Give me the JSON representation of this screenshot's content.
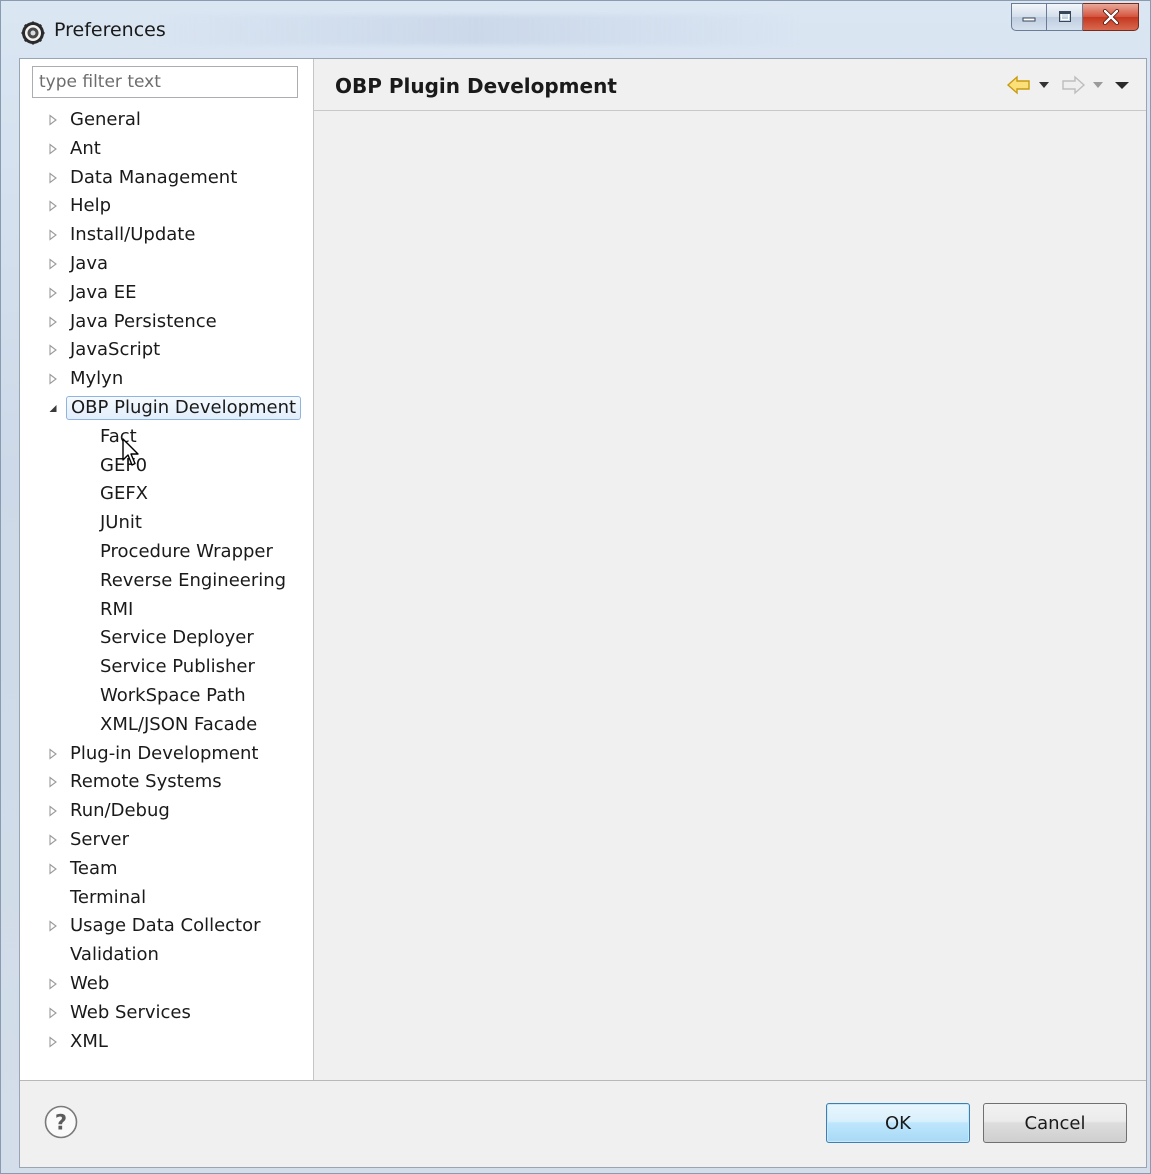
{
  "window": {
    "title": "Preferences"
  },
  "filter": {
    "placeholder": "type filter text",
    "value": ""
  },
  "tree": {
    "items": [
      {
        "label": "General",
        "expandable": true,
        "expanded": false,
        "level": 0
      },
      {
        "label": "Ant",
        "expandable": true,
        "expanded": false,
        "level": 0
      },
      {
        "label": "Data Management",
        "expandable": true,
        "expanded": false,
        "level": 0
      },
      {
        "label": "Help",
        "expandable": true,
        "expanded": false,
        "level": 0
      },
      {
        "label": "Install/Update",
        "expandable": true,
        "expanded": false,
        "level": 0
      },
      {
        "label": "Java",
        "expandable": true,
        "expanded": false,
        "level": 0
      },
      {
        "label": "Java EE",
        "expandable": true,
        "expanded": false,
        "level": 0
      },
      {
        "label": "Java Persistence",
        "expandable": true,
        "expanded": false,
        "level": 0
      },
      {
        "label": "JavaScript",
        "expandable": true,
        "expanded": false,
        "level": 0
      },
      {
        "label": "Mylyn",
        "expandable": true,
        "expanded": false,
        "level": 0
      },
      {
        "label": "OBP Plugin Development",
        "expandable": true,
        "expanded": true,
        "level": 0,
        "selected": true
      },
      {
        "label": "Fact",
        "expandable": false,
        "level": 1
      },
      {
        "label": "GEF0",
        "expandable": false,
        "level": 1
      },
      {
        "label": "GEFX",
        "expandable": false,
        "level": 1
      },
      {
        "label": "JUnit",
        "expandable": false,
        "level": 1
      },
      {
        "label": "Procedure Wrapper",
        "expandable": false,
        "level": 1
      },
      {
        "label": "Reverse Engineering",
        "expandable": false,
        "level": 1
      },
      {
        "label": "RMI",
        "expandable": false,
        "level": 1
      },
      {
        "label": "Service Deployer",
        "expandable": false,
        "level": 1
      },
      {
        "label": "Service Publisher",
        "expandable": false,
        "level": 1
      },
      {
        "label": "WorkSpace Path",
        "expandable": false,
        "level": 1
      },
      {
        "label": "XML/JSON Facade",
        "expandable": false,
        "level": 1
      },
      {
        "label": "Plug-in Development",
        "expandable": true,
        "expanded": false,
        "level": 0
      },
      {
        "label": "Remote Systems",
        "expandable": true,
        "expanded": false,
        "level": 0
      },
      {
        "label": "Run/Debug",
        "expandable": true,
        "expanded": false,
        "level": 0
      },
      {
        "label": "Server",
        "expandable": true,
        "expanded": false,
        "level": 0
      },
      {
        "label": "Team",
        "expandable": true,
        "expanded": false,
        "level": 0
      },
      {
        "label": "Terminal",
        "expandable": false,
        "level": 0
      },
      {
        "label": "Usage Data Collector",
        "expandable": true,
        "expanded": false,
        "level": 0
      },
      {
        "label": "Validation",
        "expandable": false,
        "level": 0
      },
      {
        "label": "Web",
        "expandable": true,
        "expanded": false,
        "level": 0
      },
      {
        "label": "Web Services",
        "expandable": true,
        "expanded": false,
        "level": 0
      },
      {
        "label": "XML",
        "expandable": true,
        "expanded": false,
        "level": 0
      }
    ]
  },
  "page": {
    "title": "OBP Plugin Development"
  },
  "buttons": {
    "ok": "OK",
    "cancel": "Cancel"
  },
  "icons": {
    "app": "eclipse-preferences-icon",
    "help": "help-question-icon",
    "back": "back-arrow-icon",
    "forward": "forward-arrow-icon",
    "menu": "view-menu-icon"
  },
  "colors": {
    "selection_border": "#8fb4e0",
    "selection_fill": "#e2eefb",
    "back_arrow": "#e8b81c",
    "ok_border": "#3c7fb1",
    "close_button": "#c4371f"
  }
}
